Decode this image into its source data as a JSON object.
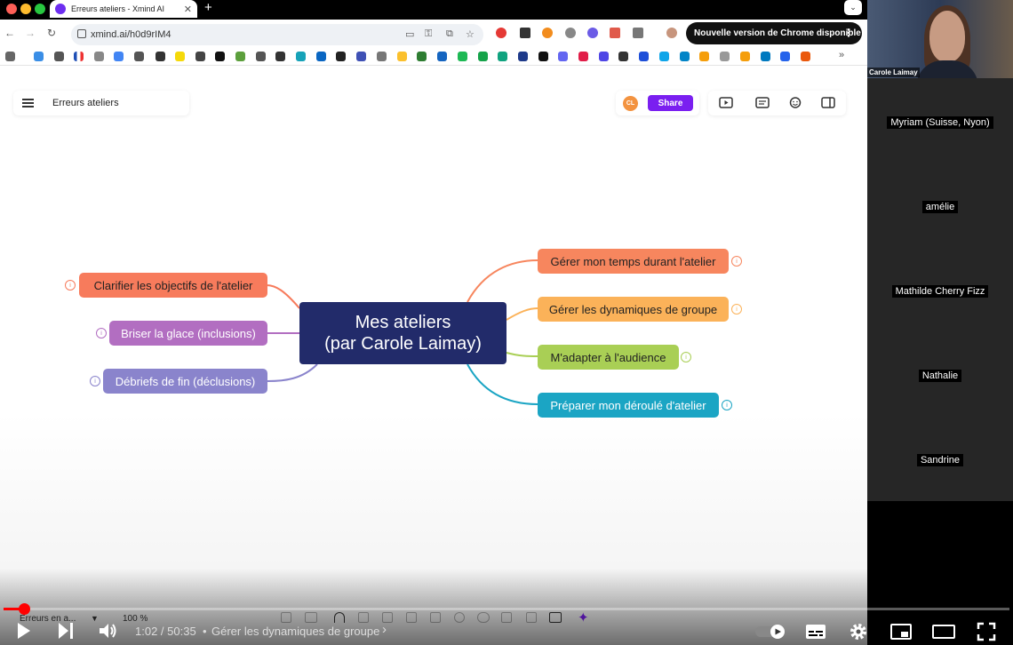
{
  "browser": {
    "tab_title": "Erreurs ateliers - Xmind AI",
    "url": "xmind.ai/h0d9rIM4",
    "update_button": "Nouvelle version de Chrome disponible"
  },
  "app": {
    "doc_title": "Erreurs ateliers",
    "avatar_initials": "CL",
    "share_label": "Share",
    "zoom_selector": "Erreurs en a...",
    "zoom_level": "100 %"
  },
  "mindmap": {
    "central_line1": "Mes ateliers",
    "central_line2": "(par Carole Laimay)",
    "left": [
      {
        "label": "Clarifier les objectifs de l'atelier",
        "color": "#f77b5c"
      },
      {
        "label": "Briser la glace (inclusions)",
        "color": "#b26ec1"
      },
      {
        "label": "Débriefs de fin (déclusions)",
        "color": "#8a84cc"
      }
    ],
    "right": [
      {
        "label": "Gérer mon temps durant l'atelier",
        "color": "#f7865e"
      },
      {
        "label": "Gérer les dynamiques de groupe",
        "color": "#fbb259"
      },
      {
        "label": "M'adapter à l'audience",
        "color": "#a9cf55"
      },
      {
        "label": "Préparer mon déroulé d'atelier",
        "color": "#1ba5c4"
      }
    ]
  },
  "meeting": {
    "self_name": "Carole Laimay",
    "participants": [
      "Myriam (Suisse, Nyon)",
      "amélie",
      "Mathilde Cherry Fizz",
      "Nathalie",
      "Sandrine"
    ]
  },
  "player": {
    "time": "1:02 / 50:35",
    "chapter": "Gérer les dynamiques de groupe",
    "progress": 0.02
  }
}
